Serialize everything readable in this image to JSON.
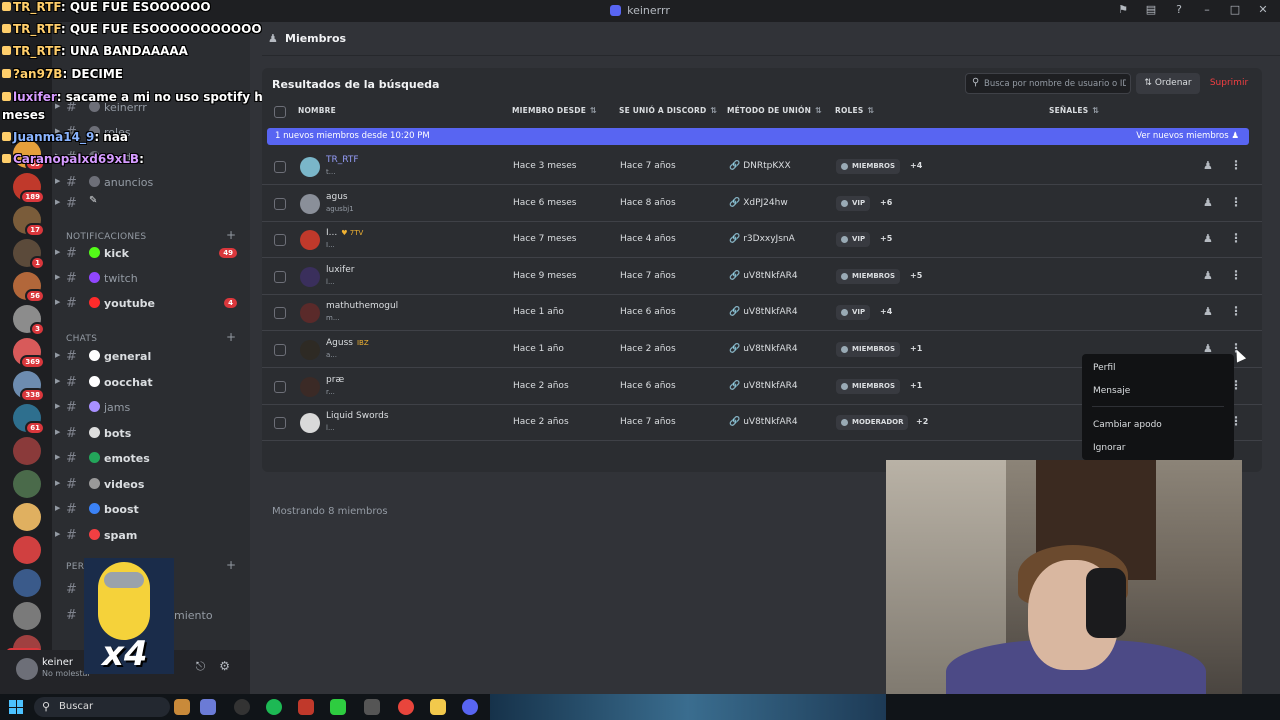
{
  "window": {
    "title": "keinerrr"
  },
  "chat_overlay": [
    {
      "user": "TR_RTF",
      "msg": ": QUE FUE ESOOOOOO",
      "cls": ""
    },
    {
      "user": "TR_RTF",
      "msg": ": QUE FUE ESOOOOOOOOOOO",
      "cls": ""
    },
    {
      "user": "TR_RTF",
      "msg": ": UNA BANDAAAAA",
      "cls": ""
    },
    {
      "user": "?an97B",
      "msg": ": DECIME",
      "cls": ""
    },
    {
      "user": "luxifer",
      "msg": ": sacame a mi no uso spotify hace",
      "cls": "p"
    },
    {
      "user": "",
      "msg": "meses",
      "cls": ""
    },
    {
      "user": "Juanma14_9",
      "msg": ": naa",
      "cls": "b"
    },
    {
      "user": "Caranopalxd69xLB",
      "msg": ":",
      "cls": "p"
    }
  ],
  "server_badges": [
    "69",
    "189",
    "17",
    "1",
    "56",
    "3",
    "369",
    "338",
    "61"
  ],
  "sidebar": {
    "top_channels": [
      {
        "name": "keinerrr",
        "dim": true
      },
      {
        "name": "roles",
        "dim": true
      },
      {
        "name": "ayuda",
        "dim": true
      },
      {
        "name": "anuncios",
        "dim": true
      }
    ],
    "notifications_category": "NOTIFICACIONES",
    "notifications": [
      {
        "name": "kick",
        "count": "49",
        "color": "#53fc18",
        "dim": false
      },
      {
        "name": "twitch",
        "count": "",
        "color": "#9146ff",
        "dim": true
      },
      {
        "name": "youtube",
        "count": "4",
        "color": "#ff2b2b",
        "dim": false
      }
    ],
    "chats_category": "CHATS",
    "chats": [
      {
        "name": "general",
        "dim": false,
        "color": "#ffffff"
      },
      {
        "name": "oocchat",
        "dim": false,
        "color": "#ffffff"
      },
      {
        "name": "jams",
        "dim": true,
        "color": "#a890ff"
      },
      {
        "name": "bots",
        "dim": false,
        "color": "#dddddd"
      },
      {
        "name": "emotes",
        "dim": false,
        "color": "#23a55a"
      },
      {
        "name": "videos",
        "dim": false,
        "color": "#999999"
      },
      {
        "name": "boost",
        "dim": false,
        "color": "#3b82f6"
      },
      {
        "name": "spam",
        "dim": false,
        "color": "#f23f42"
      }
    ],
    "bottom_category_partial": "PER",
    "bottom_channel_partial": "miento"
  },
  "user_panel": {
    "name": "keiner",
    "status": "No molestar"
  },
  "main": {
    "header_title": "Miembros",
    "results_title": "Resultados de la búsqueda",
    "search_placeholder": "Busca por nombre de usuario o ID",
    "sort_label": "Ordenar",
    "delete_label": "Suprimir",
    "columns": {
      "name": "NOMBRE",
      "member_since": "MIEMBRO DESDE",
      "joined_discord": "SE UNIÓ A DISCORD",
      "join_method": "MÉTODO DE UNIÓN",
      "roles": "ROLES",
      "signals": "SEÑALES"
    },
    "new_members_banner": "1 nuevos miembros desde 10:20 PM",
    "view_new_members": "Ver nuevos miembros",
    "members": [
      {
        "name": "TR_RTF",
        "sub": "t...",
        "link": true,
        "tag": "",
        "since": "Hace 3 meses",
        "joined": "Hace 7 años",
        "invite": "DNRtpKXX",
        "role": "MIEMBROS",
        "more": "+4",
        "avatar": "#7ab6c9"
      },
      {
        "name": "agus",
        "sub": "agusbj1",
        "link": false,
        "tag": "",
        "since": "Hace 6 meses",
        "joined": "Hace 8 años",
        "invite": "XdPJ24hw",
        "role": "VIP",
        "more": "+6",
        "avatar": "#8a8f99"
      },
      {
        "name": "I...",
        "sub": "I...",
        "link": false,
        "tag": "♥ 7TV",
        "since": "Hace 7 meses",
        "joined": "Hace 4 años",
        "invite": "r3DxxyJsnA",
        "role": "VIP",
        "more": "+5",
        "avatar": "#c0392b"
      },
      {
        "name": "luxifer",
        "sub": "l...",
        "link": false,
        "tag": "",
        "since": "Hace 9 meses",
        "joined": "Hace 7 años",
        "invite": "uV8tNkfAR4",
        "role": "MIEMBROS",
        "more": "+5",
        "avatar": "#3a2f5c"
      },
      {
        "name": "mathuthemogul",
        "sub": "m...",
        "link": false,
        "tag": "",
        "since": "Hace 1 año",
        "joined": "Hace 6 años",
        "invite": "uV8tNkfAR4",
        "role": "VIP",
        "more": "+4",
        "avatar": "#5a2a2a"
      },
      {
        "name": "Aguss",
        "sub": "a...",
        "link": false,
        "tag": "IBZ",
        "since": "Hace 1 año",
        "joined": "Hace 2 años",
        "invite": "uV8tNkfAR4",
        "role": "MIEMBROS",
        "more": "+1",
        "avatar": "#2e2a24"
      },
      {
        "name": "præ",
        "sub": "r...",
        "link": false,
        "tag": "",
        "since": "Hace 2 años",
        "joined": "Hace 6 años",
        "invite": "uV8tNkfAR4",
        "role": "MIEMBROS",
        "more": "+1",
        "avatar": "#3b2a26"
      },
      {
        "name": "Liquid Swords",
        "sub": "l...",
        "link": false,
        "tag": "",
        "since": "Hace 2 años",
        "joined": "Hace 7 años",
        "invite": "uV8tNkfAR4",
        "role": "MODERADOR",
        "more": "+2",
        "avatar": "#d9d9d9"
      }
    ],
    "showing": "Mostrando 8 miembros"
  },
  "context_menu": [
    "Perfil",
    "Mensaje",
    "Cambiar apodo",
    "Ignorar"
  ],
  "emote_text": "x4",
  "taskbar": {
    "search": "Buscar"
  }
}
